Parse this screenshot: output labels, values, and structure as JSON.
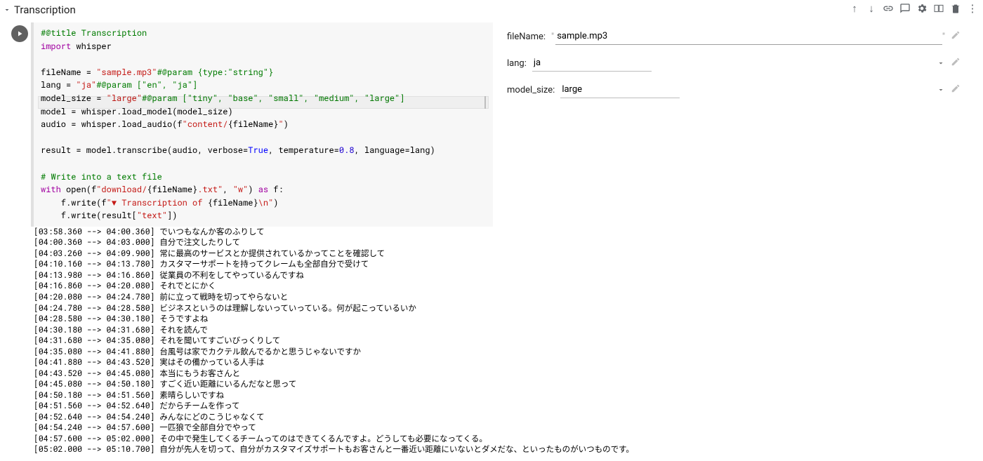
{
  "section": {
    "title": "Transcription"
  },
  "code": {
    "l1_comment": "#@title Transcription",
    "l2_kw": "import",
    "l2_mod": " whisper",
    "l3a": "fileName = ",
    "l3b": "\"sample.mp3\"",
    "l3c": "#@param {type:\"string\"}",
    "l4a": "lang = ",
    "l4b": "\"ja\"",
    "l4c": "#@param [\"en\", \"ja\"]",
    "l5a": "model_size = ",
    "l5b": "\"large\"",
    "l5c": "#@param [\"tiny\", \"base\", \"small\", \"medium\", \"large\"]",
    "l6": "model = whisper.load_model(model_size)",
    "l7a": "audio = whisper.load_audio(f",
    "l7b": "\"content/",
    "l7c": "{fileName}",
    "l7d": "\"",
    "l7e": ")",
    "l8a": "result = model.transcribe(audio, verbose=",
    "l8b": "True",
    "l8c": ", temperature=",
    "l8d": "0.8",
    "l8e": ", language=lang)",
    "l9": "# Write into a text file",
    "l10a": "with",
    "l10b": " open(f",
    "l10c": "\"download/",
    "l10d": "{fileName}",
    "l10e": ".txt\"",
    "l10f": ", ",
    "l10g": "\"w\"",
    "l10h": ") ",
    "l10i": "as",
    "l10j": " f:",
    "l11a": "    f.write(f",
    "l11b": "\"▼ Transcription of ",
    "l11c": "{fileName}",
    "l11d": "\\n\"",
    "l11e": ")",
    "l12a": "    f.write(result[",
    "l12b": "\"text\"",
    "l12c": "])"
  },
  "form": {
    "fileName_label": "fileName:",
    "fileName_value": "sample.mp3",
    "lang_label": "lang:",
    "lang_value": "ja",
    "model_size_label": "model_size:",
    "model_size_value": "large"
  },
  "output_lines": [
    "[03:58.360 --> 04:00.360] でいつもなんか客のふりして",
    "[04:00.360 --> 04:03.000] 自分で注文したりして",
    "[04:03.260 --> 04:09.900] 常に最高のサービスとか提供されているかってことを確認して",
    "[04:10.160 --> 04:13.780] カスタマーサポートを持ってクレームも全部自分で受けて",
    "[04:13.980 --> 04:16.860] 従業員の不利をしてやっているんですね",
    "[04:16.860 --> 04:20.080] それでとにかく",
    "[04:20.080 --> 04:24.780] 前に立って戦時を切ってやらないと",
    "[04:24.780 --> 04:28.580] ビジネスというのは理解しないっていっている。何が起こっているいか",
    "[04:28.580 --> 04:30.180] そうですよね",
    "[04:30.180 --> 04:31.680] それを読んで",
    "[04:31.680 --> 04:35.080] それを聞いてすごいびっくりして",
    "[04:35.080 --> 04:41.880] 台風号は家でカクテル飲んでるかと思うじゃないですか",
    "[04:41.880 --> 04:43.520] 実はその備かっている人手は",
    "[04:43.520 --> 04:45.080] 本当にもうお客さんと",
    "[04:45.080 --> 04:50.180] すごく近い距離にいるんだなと思って",
    "[04:50.180 --> 04:51.560] 素晴らしいですね",
    "[04:51.560 --> 04:52.640] だからチームを作って",
    "[04:52.640 --> 04:54.240] みんなにどのこうじゃなくて",
    "[04:54.240 --> 04:57.600] 一匹狼で全部自分でやって",
    "[04:57.600 --> 05:02.000] その中で発生してくるチームってのはできてくるんですよ。どうしても必要になってくる。",
    "[05:02.000 --> 05:10.700] 自分が先人を切って、自分がカスタマイズサポートもお客さんと一番近い距離にいないとダメだな、といったものがいつものです。"
  ]
}
